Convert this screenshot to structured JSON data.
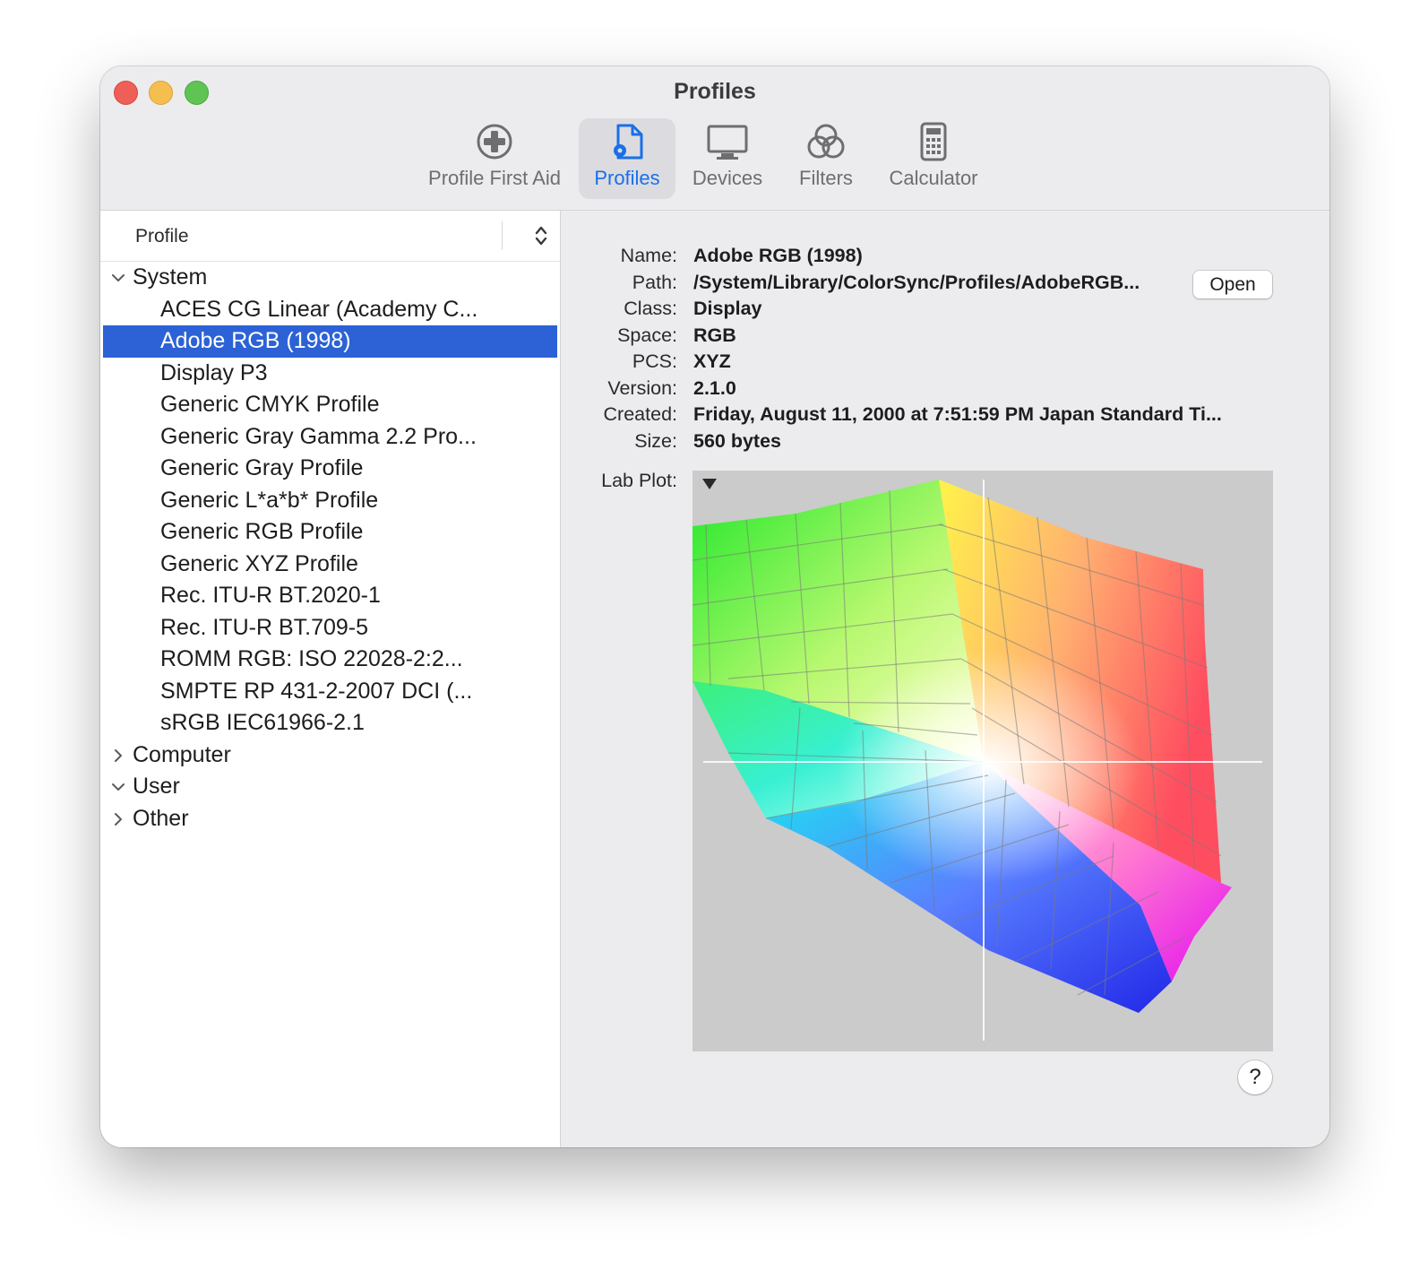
{
  "window": {
    "title": "Profiles"
  },
  "toolbar": {
    "items": [
      {
        "label": "Profile First Aid",
        "icon": "first-aid-icon",
        "active": false
      },
      {
        "label": "Profiles",
        "icon": "profile-document-icon",
        "active": true
      },
      {
        "label": "Devices",
        "icon": "display-icon",
        "active": false
      },
      {
        "label": "Filters",
        "icon": "filters-icon",
        "active": false
      },
      {
        "label": "Calculator",
        "icon": "calculator-icon",
        "active": false
      }
    ]
  },
  "sidebar": {
    "column_header": "Profile",
    "groups": [
      {
        "label": "System",
        "expanded": true,
        "items": [
          "ACES CG Linear (Academy C...",
          "Adobe RGB (1998)",
          "Display P3",
          "Generic CMYK Profile",
          "Generic Gray Gamma 2.2 Pro...",
          "Generic Gray Profile",
          "Generic L*a*b* Profile",
          "Generic RGB Profile",
          "Generic XYZ Profile",
          "Rec. ITU-R BT.2020-1",
          "Rec. ITU-R BT.709-5",
          "ROMM RGB: ISO 22028-2:2...",
          "SMPTE RP 431-2-2007 DCI (...",
          "sRGB IEC61966-2.1"
        ]
      },
      {
        "label": "Computer",
        "expanded": false,
        "items": []
      },
      {
        "label": "User",
        "expanded": true,
        "items": []
      },
      {
        "label": "Other",
        "expanded": false,
        "items": []
      }
    ],
    "selected_item": "Adobe RGB (1998)"
  },
  "details": {
    "fields": [
      {
        "key": "Name:",
        "value": "Adobe RGB (1998)"
      },
      {
        "key": "Path:",
        "value": "/System/Library/ColorSync/Profiles/AdobeRGB..."
      },
      {
        "key": "Class:",
        "value": "Display"
      },
      {
        "key": "Space:",
        "value": "RGB"
      },
      {
        "key": "PCS:",
        "value": "XYZ"
      },
      {
        "key": "Version:",
        "value": "2.1.0"
      },
      {
        "key": "Created:",
        "value": "Friday, August 11, 2000 at 7:51:59 PM Japan Standard Ti..."
      },
      {
        "key": "Size:",
        "value": "560 bytes"
      }
    ],
    "open_button": "Open",
    "lab_plot_label": "Lab Plot:",
    "help_button": "?"
  },
  "colors": {
    "accent": "#1a6fe8",
    "selection": "#2c62d6",
    "plot_background": "#cbcbcb"
  }
}
